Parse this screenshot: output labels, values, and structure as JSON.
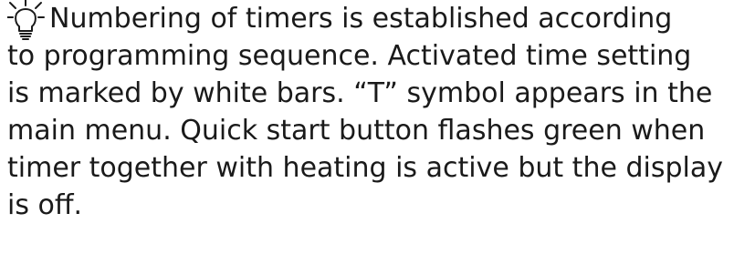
{
  "note": {
    "icon": "lightbulb-tip-icon",
    "lines": [
      "Numbering of timers is established according",
      "to programming sequence. Activated time setting",
      "is marked by white bars. “T” symbol appears in the",
      "main menu. Quick start button flashes green when",
      "timer together with heating is active but the display",
      "is off."
    ]
  }
}
